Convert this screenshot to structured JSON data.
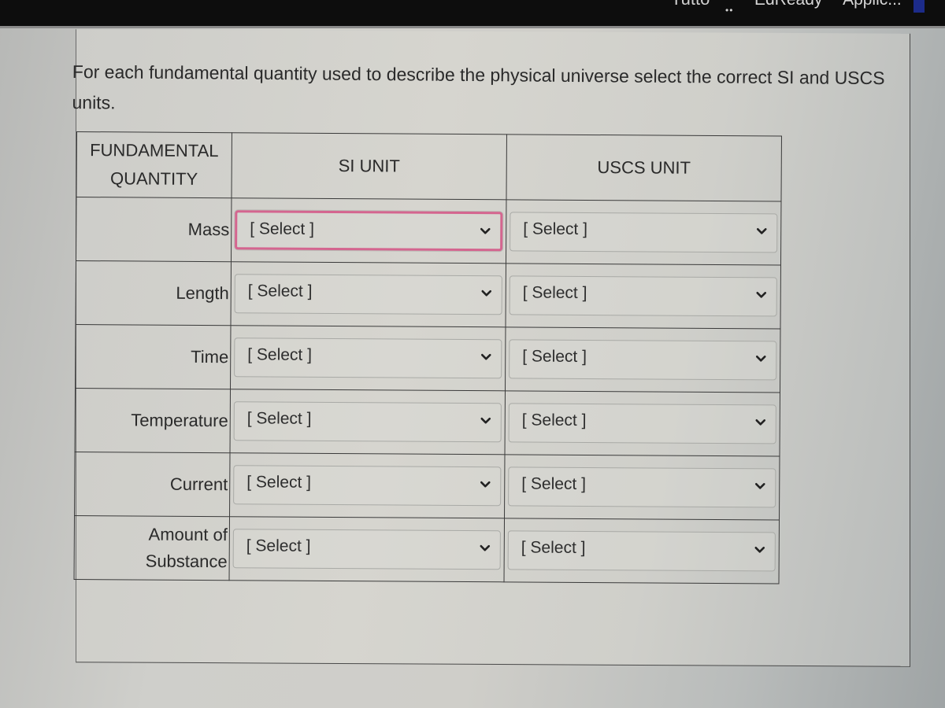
{
  "topbar": {
    "fragment_text": "Tutto",
    "dots": "••",
    "app_name": "EdReady™ Applic..."
  },
  "question": {
    "text": "For each fundamental quantity used to describe the physical universe select the correct SI and USCS units."
  },
  "table": {
    "headers": {
      "quantity": "FUNDAMENTAL QUANTITY",
      "si_unit": "SI UNIT",
      "uscs_unit": "USCS UNIT"
    },
    "rows": [
      {
        "quantity": "Mass",
        "si_selected": "[ Select ]",
        "uscs_selected": "[ Select ]",
        "si_focused": true
      },
      {
        "quantity": "Length",
        "si_selected": "[ Select ]",
        "uscs_selected": "[ Select ]",
        "si_focused": false
      },
      {
        "quantity": "Time",
        "si_selected": "[ Select ]",
        "uscs_selected": "[ Select ]",
        "si_focused": false
      },
      {
        "quantity": "Temperature",
        "si_selected": "[ Select ]",
        "uscs_selected": "[ Select ]",
        "si_focused": false
      },
      {
        "quantity": "Current",
        "si_selected": "[ Select ]",
        "uscs_selected": "[ Select ]",
        "si_focused": false
      },
      {
        "quantity": "Amount of Substance",
        "si_selected": "[ Select ]",
        "uscs_selected": "[ Select ]",
        "si_focused": false
      }
    ]
  },
  "icons": {
    "dropdown": "chevron-down-icon"
  },
  "colors": {
    "focus_border": "#d4658f",
    "topbar_bg": "#0d0d0d",
    "text": "#2a2a2a"
  }
}
